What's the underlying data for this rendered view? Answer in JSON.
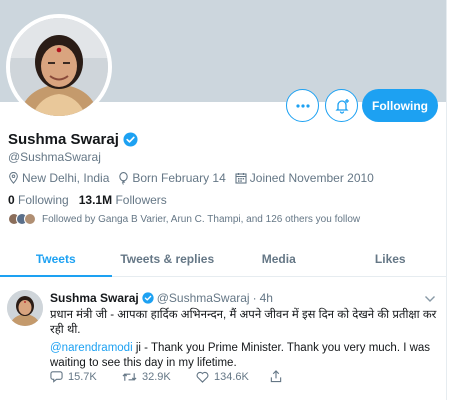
{
  "profile": {
    "name": "Sushma Swaraj",
    "handle": "@SushmaSwaraj",
    "location": "New Delhi, India",
    "birthday": "Born February 14",
    "joined": "Joined November 2010",
    "following_count": "0",
    "following_label": "Following",
    "followers_count": "13.1M",
    "followers_label": "Followers",
    "followed_by": "Followed by Ganga B Varier, Arun C. Thampi, and 126 others you follow",
    "follow_button_label": "Following"
  },
  "tabs": [
    {
      "label": "Tweets"
    },
    {
      "label": "Tweets & replies"
    },
    {
      "label": "Media"
    },
    {
      "label": "Likes"
    }
  ],
  "tweet": {
    "name": "Sushma Swaraj",
    "handle": "@SushmaSwaraj",
    "separator": "·",
    "time": "4h",
    "hindi_text": "प्रधान मंत्री जी - आपका हार्दिक अभिनन्दन, मैं अपने जीवन में इस दिन को देखने की प्रतीक्षा कर रही थी.",
    "mention": "@narendramodi",
    "english_text": " ji - Thank you Prime Minister. Thank you very much. I was waiting to see this day in my lifetime.",
    "replies": "15.7K",
    "retweets": "32.9K",
    "likes": "134.6K"
  },
  "icons": {
    "more": "more-icon",
    "bell": "bell-plus-icon",
    "verified": "verified-badge-icon",
    "location": "location-pin-icon",
    "birthday": "balloon-icon",
    "calendar": "calendar-icon",
    "reply": "reply-icon",
    "retweet": "retweet-icon",
    "like": "heart-icon",
    "share": "share-icon",
    "chevron": "chevron-down-icon"
  },
  "colors": {
    "accent": "#1da1f2",
    "banner": "#ccd6dd",
    "secondary_text": "#657786"
  }
}
